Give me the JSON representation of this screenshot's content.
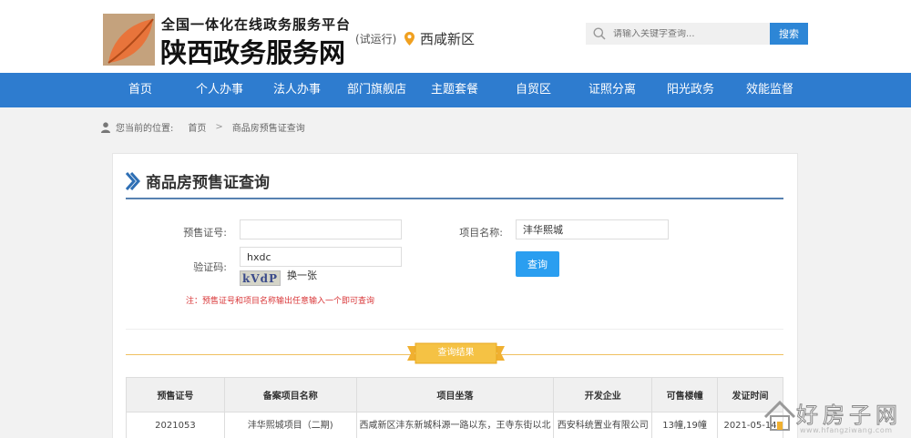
{
  "header": {
    "logo_top": "全国一体化在线政务服务平台",
    "logo_main": "陕西政务服务网",
    "trial": "(试运行)",
    "region": "西咸新区",
    "search_placeholder": "请输入关键字查询...",
    "search_label": "搜索",
    "brand_colors": [
      "#c07a3a",
      "#e8743b",
      "#a84a1d"
    ]
  },
  "nav": {
    "color": "#2e7ccf",
    "items": [
      "首页",
      "个人办事",
      "法人办事",
      "部门旗舰店",
      "主题套餐",
      "自贸区",
      "证照分离",
      "阳光政务",
      "效能监督"
    ]
  },
  "breadcrumb": {
    "prefix": "您当前的位置:",
    "home": "首页",
    "separator": ">",
    "current": "商品房预售证查询"
  },
  "form": {
    "title": "商品房预售证查询",
    "presale_label": "预售证号:",
    "presale_value": "",
    "project_label": "项目名称:",
    "project_value": "沣华熙城",
    "captcha_label": "验证码:",
    "captcha_value": "hxdc",
    "captcha_image_text": "kVdP",
    "refresh_label": "换一张",
    "query_label": "查询",
    "note": "注：预售证号和项目名称输出任意输入一个即可查询"
  },
  "results": {
    "banner": "查询结果",
    "columns": [
      "预售证号",
      "备案项目名称",
      "项目坐落",
      "开发企业",
      "可售楼幢",
      "发证时间"
    ],
    "rows": [
      [
        "2021053",
        "沣华熙城项目（二期)",
        "西咸新区沣东新城科源一路以东，王寺东街以北",
        "西安科统置业有限公司",
        "13幢,19幢",
        "2021-05-14"
      ]
    ]
  },
  "watermark": {
    "text": "好房子网",
    "url": "www.hfangziwang.com"
  }
}
